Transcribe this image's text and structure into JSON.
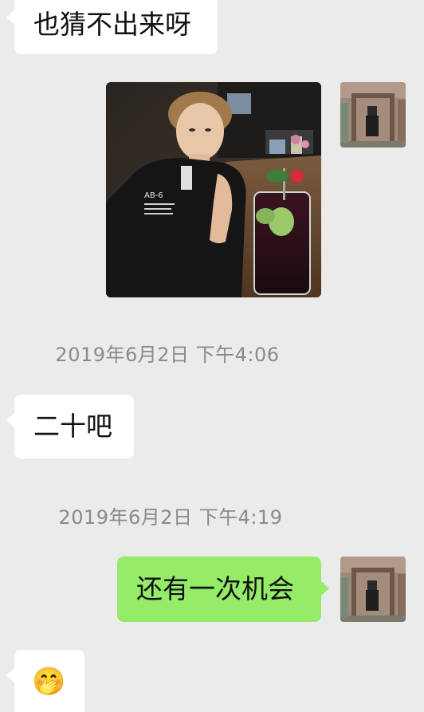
{
  "messages": {
    "m1_text": "也猜不出来呀",
    "m3_text": "二十吧",
    "m4_text": "还有一次机会",
    "m5_emoji": "🤭"
  },
  "timestamps": {
    "t1": "2019年6月2日 下午4:06",
    "t2": "2019年6月2日 下午4:19"
  },
  "colors": {
    "background": "#ebebeb",
    "incoming_bubble": "#ffffff",
    "outgoing_bubble": "#95ec69",
    "timestamp_text": "#8a8a8a"
  }
}
